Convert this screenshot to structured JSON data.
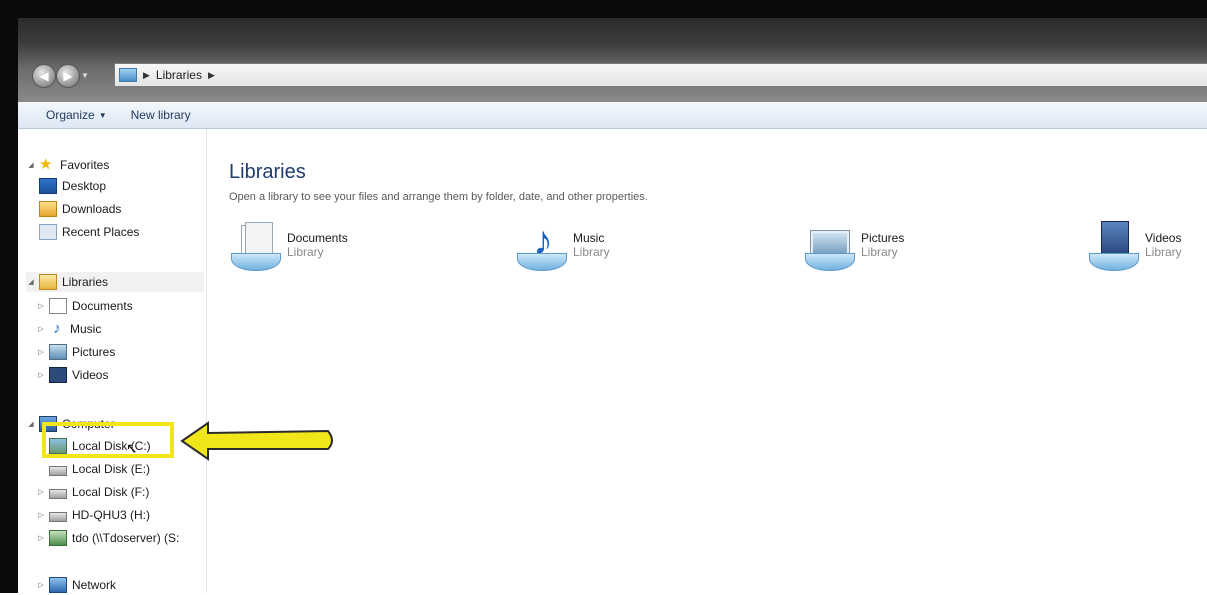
{
  "address": {
    "crumbs": [
      "Libraries"
    ]
  },
  "toolbar": {
    "organize": "Organize",
    "new_library": "New library"
  },
  "nav": {
    "favorites": {
      "label": "Favorites",
      "items": [
        "Desktop",
        "Downloads",
        "Recent Places"
      ]
    },
    "libraries": {
      "label": "Libraries",
      "items": [
        "Documents",
        "Music",
        "Pictures",
        "Videos"
      ]
    },
    "computer": {
      "label": "Computer",
      "items": [
        "Local Disk (C:)",
        "Local Disk (E:)",
        "Local Disk (F:)",
        "HD-QHU3 (H:)",
        "tdo (\\\\Tdoserver) (S:"
      ]
    },
    "network": {
      "label": "Network"
    }
  },
  "main": {
    "title": "Libraries",
    "subtitle": "Open a library to see your files and arrange them by folder, date, and other properties.",
    "libraries": [
      {
        "name": "Documents",
        "type": "Library"
      },
      {
        "name": "Music",
        "type": "Library"
      },
      {
        "name": "Pictures",
        "type": "Library"
      },
      {
        "name": "Videos",
        "type": "Library"
      }
    ]
  },
  "annotation": {
    "color": "#f1e61a"
  }
}
